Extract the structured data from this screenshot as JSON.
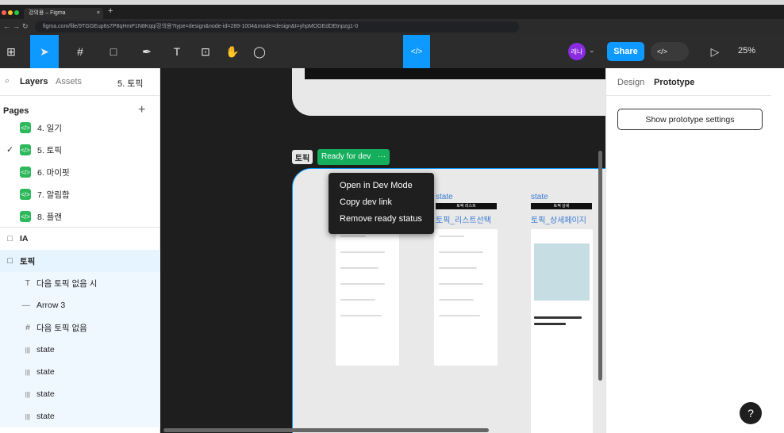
{
  "browser": {
    "app": "Google Chrome",
    "tab_title": "강의용 – Figma",
    "url": "figma.com/file/9TGGEup6s7P8qHmP1N8Kqq/강의용?type=design&node-id=289-1004&mode=design&t=yhpMOGEdDEtnpzg1-0",
    "new_tab": "+",
    "close_tab": "×"
  },
  "toolbar": {
    "share": "Share",
    "zoom": "25%",
    "avatar": "레나",
    "dev_icon": "</>"
  },
  "left": {
    "tabs": {
      "layers": "Layers",
      "assets": "Assets",
      "page": "5. 토픽"
    },
    "pages_header": "Pages",
    "add": "+",
    "pages": [
      {
        "label": "4. 일기"
      },
      {
        "label": "5. 토픽",
        "check": "✓"
      },
      {
        "label": "6. 마이핏"
      },
      {
        "label": "7. 알림함"
      },
      {
        "label": "8. 플랜"
      }
    ],
    "layers": [
      {
        "label": "IA",
        "icon": "□"
      },
      {
        "label": "토픽",
        "icon": "□"
      },
      {
        "label": "다음 토픽 없음 시",
        "icon": "T"
      },
      {
        "label": "Arrow 3",
        "icon": "—"
      },
      {
        "label": "다음 토픽 없음",
        "icon": "#"
      },
      {
        "label": "state",
        "icon": "|||"
      },
      {
        "label": "state",
        "icon": "|||"
      },
      {
        "label": "state",
        "icon": "|||"
      },
      {
        "label": "state",
        "icon": "|||"
      }
    ]
  },
  "canvas": {
    "frame_label": "토픽",
    "ready": "Ready for dev",
    "more": "···",
    "menu": [
      "Open in Dev Mode",
      "Copy dev link",
      "Remove ready status"
    ],
    "columns": [
      {
        "state": "state",
        "tag": "토픽 리스트",
        "title": "토픽_리스트선택"
      },
      {
        "state": "state",
        "tag": "토픽 상세",
        "title": "토픽_상세페이지"
      }
    ]
  },
  "right": {
    "tabs": {
      "design": "Design",
      "prototype": "Prototype"
    },
    "button": "Show prototype settings"
  },
  "help": "?"
}
